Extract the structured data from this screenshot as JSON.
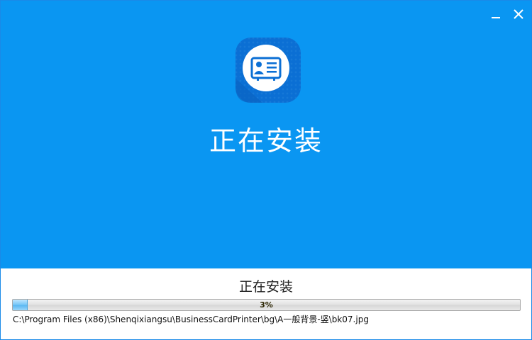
{
  "window": {
    "minimize_icon": "minimize-icon",
    "close_icon": "close-icon"
  },
  "hero": {
    "logo_icon": "business-card-icon",
    "title": "正在安装"
  },
  "install": {
    "status": "正在安装",
    "progress_percent": 3,
    "progress_label": "3%",
    "current_file": "C:\\Program Files (x86)\\Shenqixiangsu\\BusinessCardPrinter\\bg\\A一般背景-竖\\bk07.jpg"
  },
  "colors": {
    "hero_bg": "#0a96f2",
    "logo_dark": "#0b6fd4",
    "progress_fill": "#7cc9f8"
  }
}
